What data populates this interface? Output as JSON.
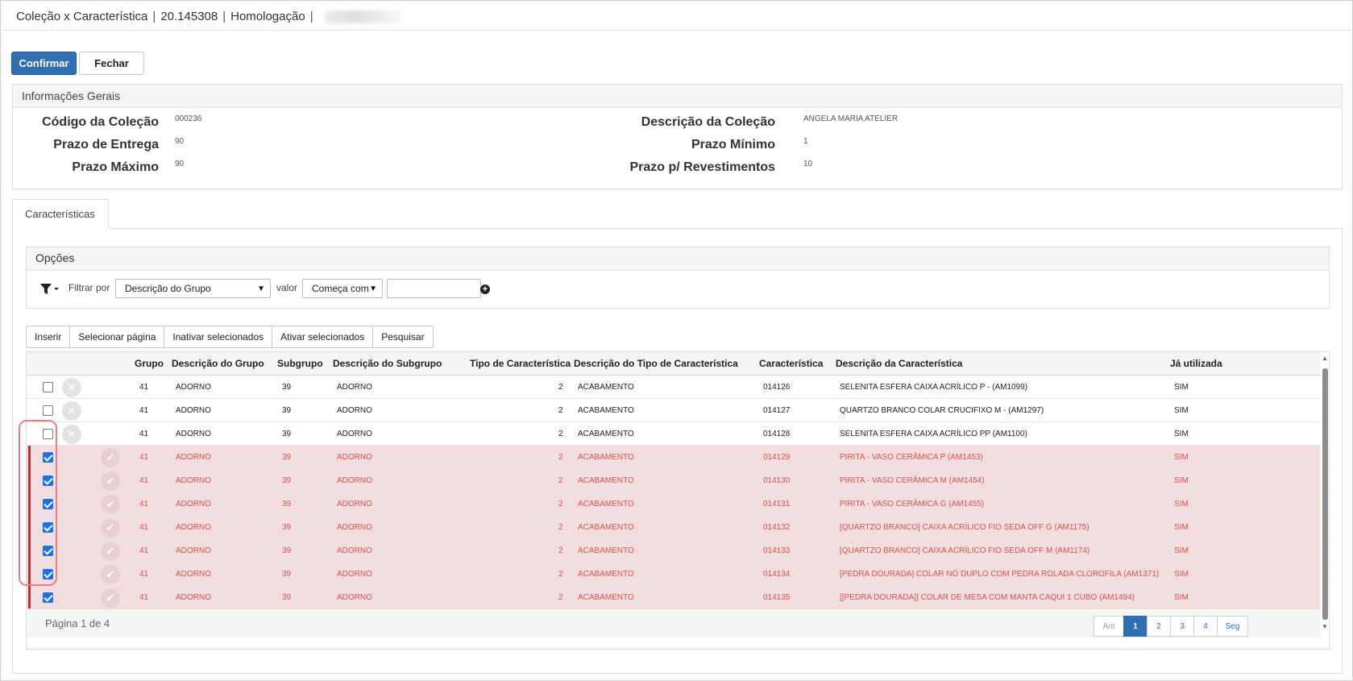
{
  "window": {
    "title_parts": [
      "Coleção x Característica",
      "20.145308",
      "Homologação"
    ],
    "separator": "|"
  },
  "actions": {
    "confirm_label": "Confirmar",
    "close_label": "Fechar"
  },
  "geral": {
    "title": "Informações Gerais",
    "fields": {
      "codigo_colecao": {
        "label": "Código da Coleção",
        "value": "000236"
      },
      "prazo_entrega": {
        "label": "Prazo de Entrega",
        "value": "90"
      },
      "prazo_maximo": {
        "label": "Prazo Máximo",
        "value": "90"
      },
      "descricao_colecao": {
        "label": "Descrição da Coleção",
        "value": "ANGELA MARIA ATELIER"
      },
      "prazo_minimo": {
        "label": "Prazo Mínimo",
        "value": "1"
      },
      "prazo_revestimentos": {
        "label": "Prazo p/ Revestimentos",
        "value": "10"
      }
    }
  },
  "tab": {
    "label": "Características"
  },
  "opcoes": {
    "title": "Opções",
    "filter_label": "Filtrar por",
    "filter_field": "Descrição do Grupo",
    "value_label": "valor",
    "operator": "Começa com",
    "search_value": ""
  },
  "toolbar": {
    "inserir": "Inserir",
    "selecionar_pagina": "Selecionar página",
    "inativar": "Inativar selecionados",
    "ativar": "Ativar selecionados",
    "pesquisar": "Pesquisar"
  },
  "table": {
    "columns": [
      "Grupo",
      "Descrição do Grupo",
      "Subgrupo",
      "Descrição do Subgrupo",
      "Tipo de Característica",
      "Descrição do Tipo de Característica",
      "Característica",
      "Descrição da Característica",
      "Já utilizada"
    ],
    "rows": [
      {
        "checked": false,
        "inactive": false,
        "grupo": "41",
        "desc_grupo": "ADORNO",
        "subgrupo": "39",
        "desc_subgrupo": "ADORNO",
        "tipo": "2",
        "desc_tipo": "ACABAMENTO",
        "caracteristica": "014126",
        "desc_caracteristica": "SELENITA ESFERA CAIXA ACRÍLICO P - (AM1099)",
        "ja_utilizada": "SIM"
      },
      {
        "checked": false,
        "inactive": false,
        "grupo": "41",
        "desc_grupo": "ADORNO",
        "subgrupo": "39",
        "desc_subgrupo": "ADORNO",
        "tipo": "2",
        "desc_tipo": "ACABAMENTO",
        "caracteristica": "014127",
        "desc_caracteristica": "QUARTZO BRANCO COLAR CRUCIFIXO M - (AM1297)",
        "ja_utilizada": "SIM"
      },
      {
        "checked": false,
        "inactive": false,
        "grupo": "41",
        "desc_grupo": "ADORNO",
        "subgrupo": "39",
        "desc_subgrupo": "ADORNO",
        "tipo": "2",
        "desc_tipo": "ACABAMENTO",
        "caracteristica": "014128",
        "desc_caracteristica": "SELENITA ESFERA CAIXA ACRÍLICO PP (AM1100)",
        "ja_utilizada": "SIM"
      },
      {
        "checked": true,
        "inactive": true,
        "grupo": "41",
        "desc_grupo": "ADORNO",
        "subgrupo": "39",
        "desc_subgrupo": "ADORNO",
        "tipo": "2",
        "desc_tipo": "ACABAMENTO",
        "caracteristica": "014129",
        "desc_caracteristica": "PIRITA - VASO CERÂMICA P (AM1453)",
        "ja_utilizada": "SIM"
      },
      {
        "checked": true,
        "inactive": true,
        "grupo": "41",
        "desc_grupo": "ADORNO",
        "subgrupo": "39",
        "desc_subgrupo": "ADORNO",
        "tipo": "2",
        "desc_tipo": "ACABAMENTO",
        "caracteristica": "014130",
        "desc_caracteristica": "PIRITA - VASO CERÂMICA M (AM1454)",
        "ja_utilizada": "SIM"
      },
      {
        "checked": true,
        "inactive": true,
        "grupo": "41",
        "desc_grupo": "ADORNO",
        "subgrupo": "39",
        "desc_subgrupo": "ADORNO",
        "tipo": "2",
        "desc_tipo": "ACABAMENTO",
        "caracteristica": "014131",
        "desc_caracteristica": "PIRITA - VASO CERÂMICA G (AM1455)",
        "ja_utilizada": "SIM"
      },
      {
        "checked": true,
        "inactive": true,
        "grupo": "41",
        "desc_grupo": "ADORNO",
        "subgrupo": "39",
        "desc_subgrupo": "ADORNO",
        "tipo": "2",
        "desc_tipo": "ACABAMENTO",
        "caracteristica": "014132",
        "desc_caracteristica": "[QUARTZO BRANCO] CAIXA ACRÍLICO FIO SEDA OFF G (AM1175)",
        "ja_utilizada": "SIM"
      },
      {
        "checked": true,
        "inactive": true,
        "grupo": "41",
        "desc_grupo": "ADORNO",
        "subgrupo": "39",
        "desc_subgrupo": "ADORNO",
        "tipo": "2",
        "desc_tipo": "ACABAMENTO",
        "caracteristica": "014133",
        "desc_caracteristica": "[QUARTZO BRANCO] CAIXA ACRÍLICO FIO SEDA OFF M (AM1174)",
        "ja_utilizada": "SIM"
      },
      {
        "checked": true,
        "inactive": true,
        "grupo": "41",
        "desc_grupo": "ADORNO",
        "subgrupo": "39",
        "desc_subgrupo": "ADORNO",
        "tipo": "2",
        "desc_tipo": "ACABAMENTO",
        "caracteristica": "014134",
        "desc_caracteristica": "[PEDRA DOURADA] COLAR NÓ DUPLO COM PEDRA ROLADA CLOROFILA (AM1371)",
        "ja_utilizada": "SIM"
      },
      {
        "checked": true,
        "inactive": true,
        "grupo": "41",
        "desc_grupo": "ADORNO",
        "subgrupo": "39",
        "desc_subgrupo": "ADORNO",
        "tipo": "2",
        "desc_tipo": "ACABAMENTO",
        "caracteristica": "014135",
        "desc_caracteristica": "[[PEDRA DOURADA]] COLAR DE MESA COM MANTA CAQUI 1 CUBO (AM1494)",
        "ja_utilizada": "SIM"
      }
    ]
  },
  "pagination": {
    "info": "Página 1 de 4",
    "prev": "Ant",
    "next": "Seg",
    "pages": [
      "1",
      "2",
      "3",
      "4"
    ],
    "current": "1"
  },
  "colors": {
    "primary": "#2f6fb2",
    "inactive_row_bg": "#f2dede",
    "inactive_text": "#d9534f",
    "highlight": "#f08080"
  }
}
